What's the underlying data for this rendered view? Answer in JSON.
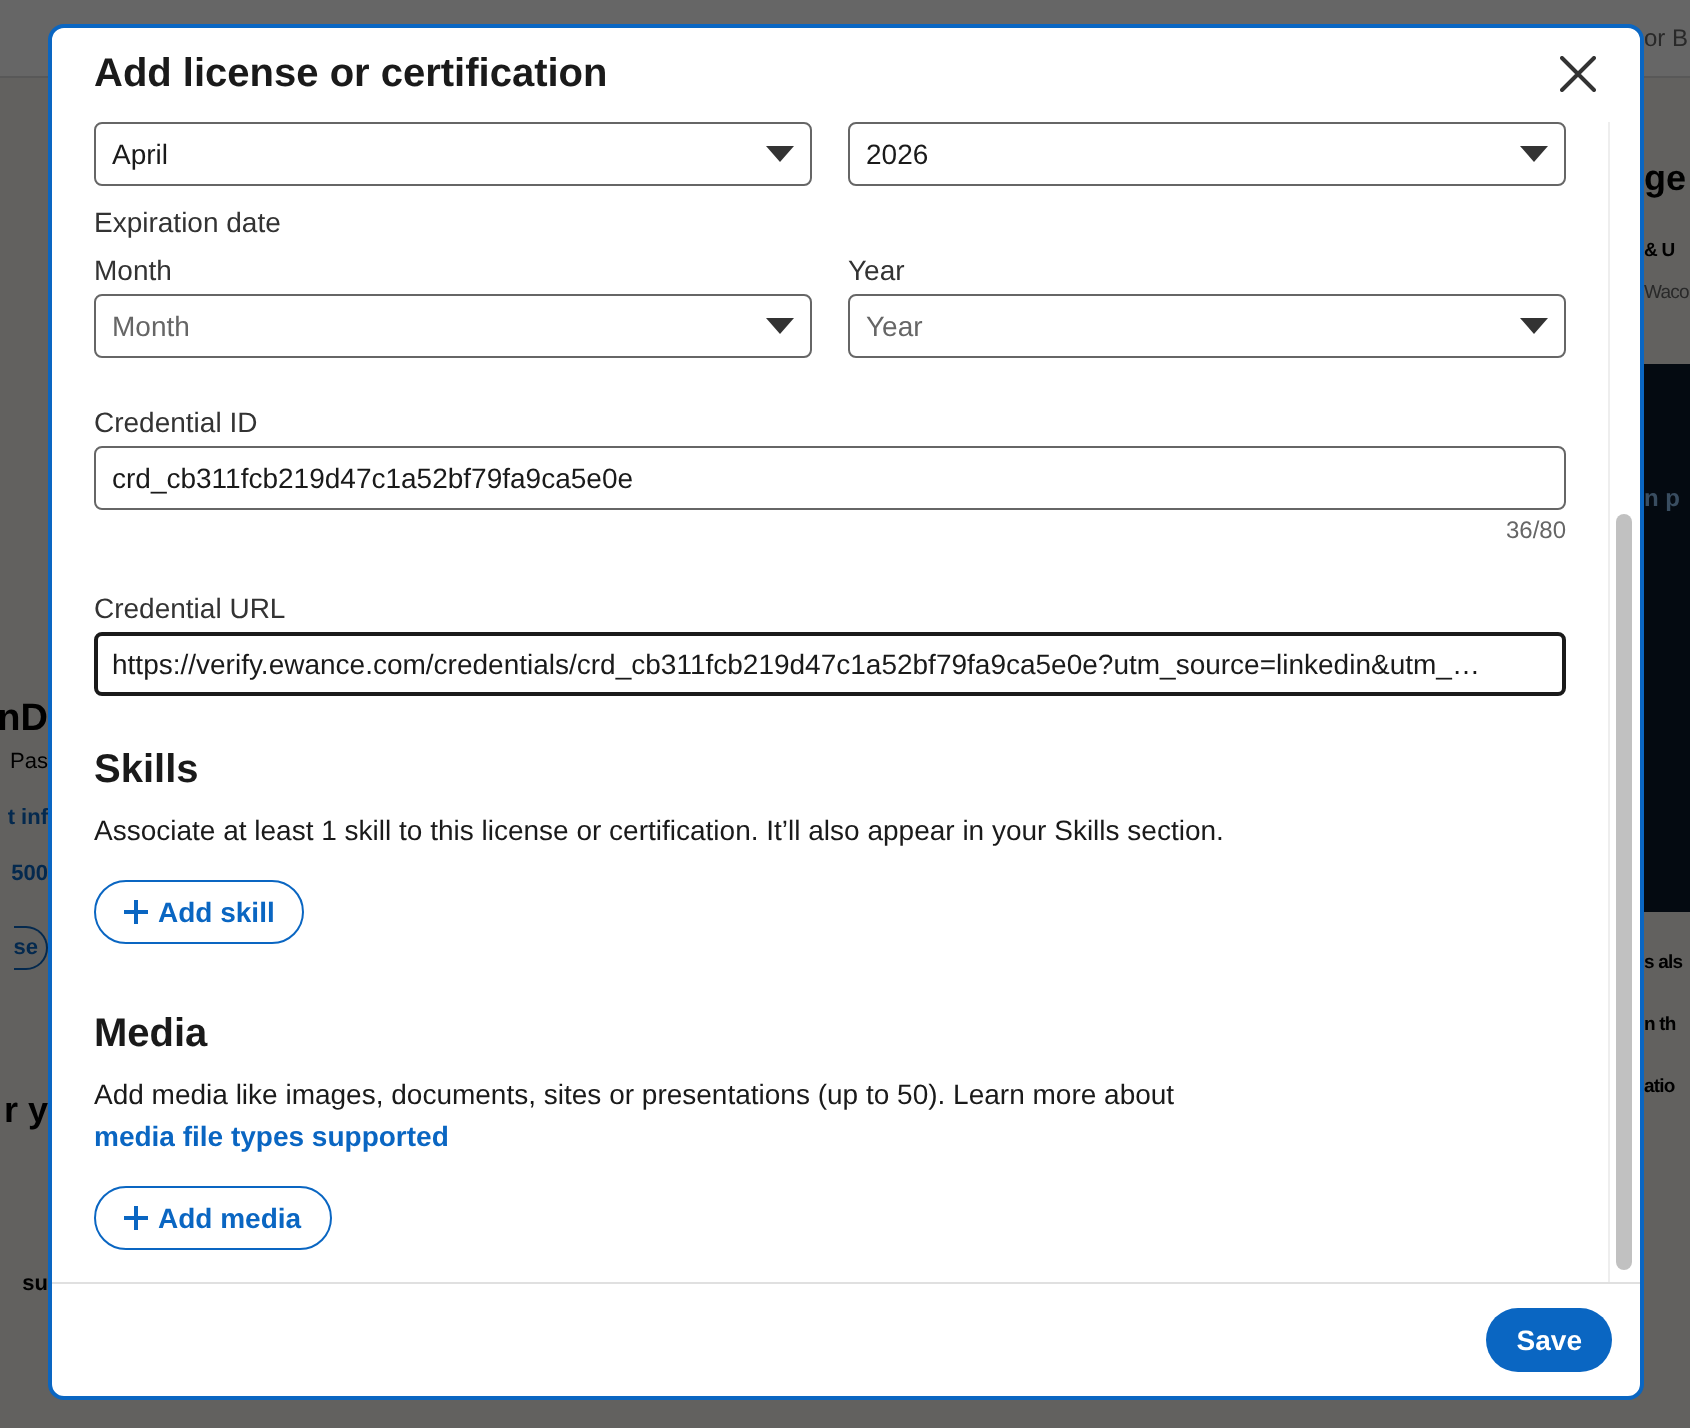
{
  "background": {
    "nav_text": "or B",
    "left": [
      {
        "kind": "name",
        "text": "nD"
      },
      {
        "kind": "plain",
        "text": "Pas"
      },
      {
        "kind": "link",
        "text": "t inf"
      },
      {
        "kind": "link",
        "text": "500"
      },
      {
        "kind": "button",
        "text": "se"
      },
      {
        "kind": "heading",
        "text": "r y"
      },
      {
        "kind": "bold",
        "text": "su"
      }
    ],
    "right": [
      {
        "kind": "heading",
        "text": "ge"
      },
      {
        "kind": "bold",
        "text": "& U"
      },
      {
        "kind": "plain",
        "text": "Waco"
      },
      {
        "kind": "banner",
        "text": "n p"
      },
      {
        "kind": "bold",
        "text": "s als"
      },
      {
        "kind": "bold",
        "text": "n th"
      },
      {
        "kind": "bold",
        "text": "atio"
      }
    ]
  },
  "dialog": {
    "title": "Add license or certification",
    "issue_date": {
      "month": "April",
      "year": "2026"
    },
    "expiration_date": {
      "label": "Expiration date",
      "month": {
        "label": "Month",
        "placeholder": "Month"
      },
      "year": {
        "label": "Year",
        "placeholder": "Year"
      }
    },
    "credential_id": {
      "label": "Credential ID",
      "value": "crd_cb311fcb219d47c1a52bf79fa9ca5e0e",
      "counter": "36/80",
      "focused": false
    },
    "credential_url": {
      "label": "Credential URL",
      "value": "https://verify.ewance.com/credentials/crd_cb311fcb219d47c1a52bf79fa9ca5e0e?utm_source=linkedin&utm_…",
      "focused": true
    },
    "skills": {
      "title": "Skills",
      "description": "Associate at least 1 skill to this license or certification. It’ll also appear in your Skills section.",
      "button": "Add skill"
    },
    "media": {
      "title": "Media",
      "description": "Add media like images, documents, sites or presentations (up to 50). Learn more about ",
      "link": "media file types supported",
      "button": "Add media"
    },
    "save": "Save"
  }
}
